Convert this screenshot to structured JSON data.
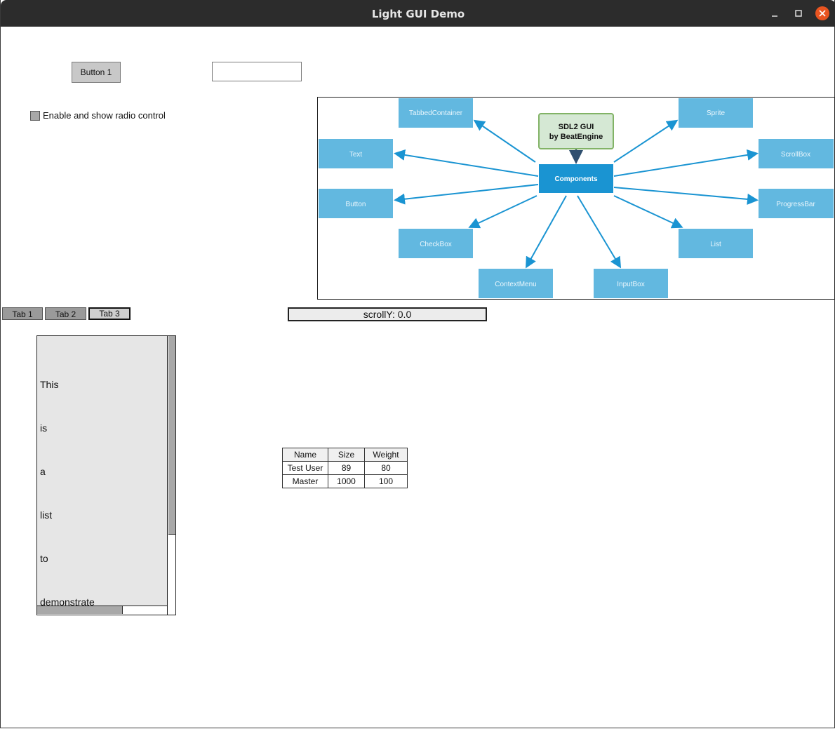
{
  "window": {
    "title": "Light GUI Demo",
    "buttons": [
      "minimize-icon",
      "maximize-icon",
      "close-icon"
    ],
    "close_color": "#e95420"
  },
  "controls": {
    "button1_label": "Button 1",
    "text_input_value": "",
    "checkbox_label": "Enable and show radio control",
    "checkbox_checked": false
  },
  "diagram": {
    "root_line1": "SDL2 GUI",
    "root_line2": "by BeatEngine",
    "center": "Components",
    "nodes": {
      "tabbed": "TabbedContainer",
      "sprite": "Sprite",
      "text": "Text",
      "scrollbox": "ScrollBox",
      "button": "Button",
      "progressbar": "ProgressBar",
      "checkbox": "CheckBox",
      "list": "List",
      "contextmenu": "ContextMenu",
      "inputbox": "InputBox"
    },
    "colors": {
      "node": "#62b8e0",
      "center": "#1a94d2",
      "root_fill": "#d5e8d4",
      "root_border": "#82b366",
      "arrow": "#1a94d2"
    }
  },
  "tabs": [
    "Tab 1",
    "Tab 2",
    "Tab 3"
  ],
  "active_tab": "Tab 3",
  "scroll_indicator": "scrollY: 0.0",
  "list": {
    "items": [
      "This",
      "is",
      "a",
      "list",
      "to",
      "demonstrate"
    ]
  },
  "table": {
    "headers": [
      "Name",
      "Size",
      "Weight"
    ],
    "rows": [
      [
        "Test User",
        "89",
        "80"
      ],
      [
        "Master",
        "1000",
        "100"
      ]
    ]
  }
}
